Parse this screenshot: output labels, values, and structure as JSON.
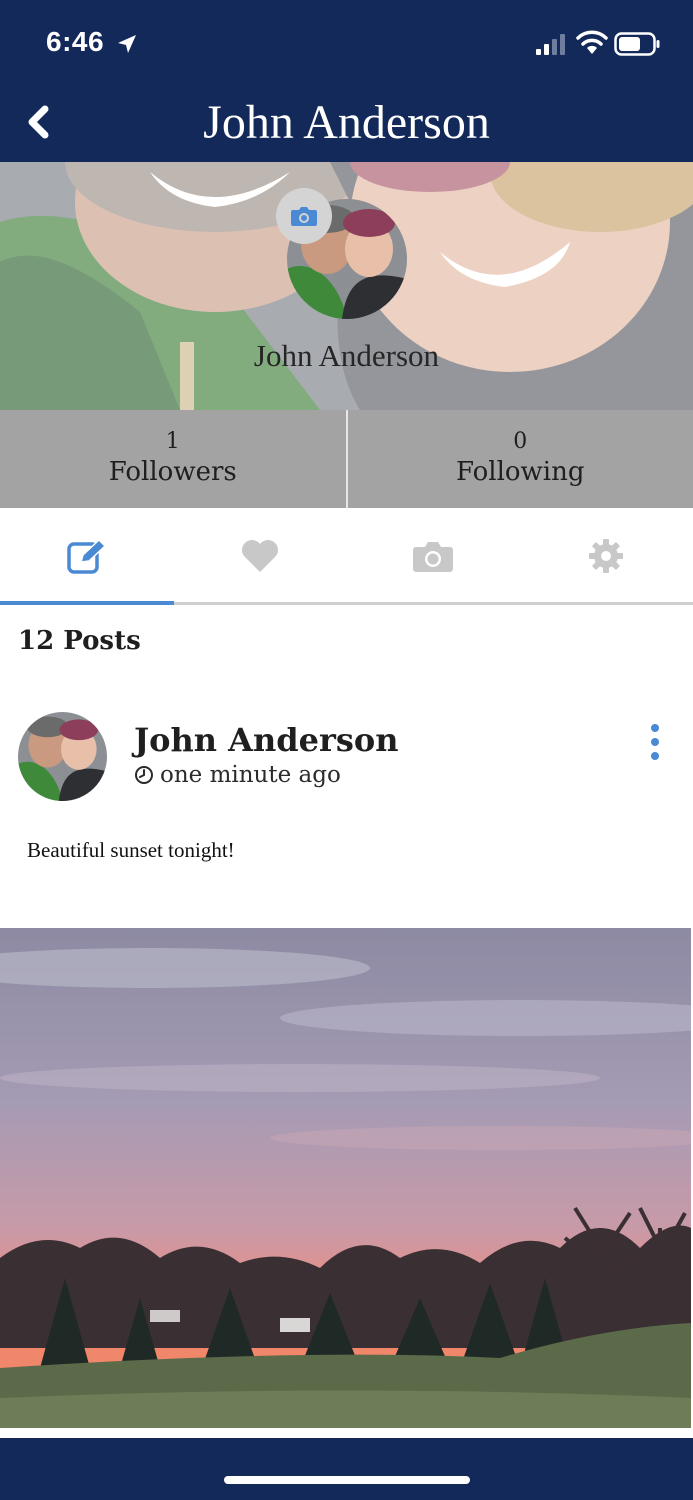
{
  "status_bar": {
    "time": "6:46",
    "icons": [
      "location-arrow-icon",
      "cellular-signal-icon",
      "wifi-icon",
      "battery-icon"
    ]
  },
  "header": {
    "title": "John Anderson",
    "back_icon": "chevron-left-icon"
  },
  "profile": {
    "name": "John Anderson",
    "camera_icon": "camera-icon"
  },
  "stats": {
    "followers": {
      "count": "1",
      "label": "Followers"
    },
    "following": {
      "count": "0",
      "label": "Following"
    }
  },
  "tabs": [
    {
      "icon": "edit-post-icon",
      "active": true
    },
    {
      "icon": "heart-icon",
      "active": false
    },
    {
      "icon": "camera-icon",
      "active": false
    },
    {
      "icon": "gear-icon",
      "active": false
    }
  ],
  "posts_count": "12 Posts",
  "post": {
    "author": "John Anderson",
    "time": "one minute ago",
    "text": "Beautiful sunset tonight!"
  },
  "colors": {
    "header_bg": "#13295a",
    "accent": "#4a8ad4",
    "stats_bg": "#a3a3a3",
    "inactive_icon": "#c8c8c8"
  }
}
